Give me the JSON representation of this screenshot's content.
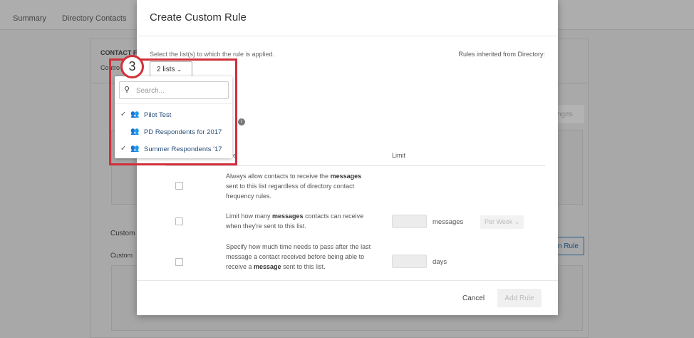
{
  "background": {
    "tabs": [
      "Summary",
      "Directory Contacts"
    ],
    "contact_heading": "CONTACT F",
    "contact_sub": "Contro",
    "custom_heading": "Custom",
    "custom_sub": "Custom",
    "save_changes_fragment": "nges",
    "add_rule_fragment": "n Rule"
  },
  "modal": {
    "title": "Create Custom Rule",
    "select_label": "Select the list(s) to which the rule is applied.",
    "inherited_label": "Rules inherited from Directory:",
    "lists_button": "2 lists",
    "column_rule_fragment": "e",
    "column_limit": "Limit",
    "rules": [
      {
        "html_parts": [
          "Always allow contacts to receive the ",
          "messages",
          " sent to this list regardless of directory contact frequency rules."
        ]
      },
      {
        "html_parts": [
          "Limit how many ",
          "messages",
          " contacts can receive when they're sent to this list."
        ],
        "unit": "messages",
        "period": "Per Week"
      },
      {
        "html_parts": [
          "Specify how much time needs to pass after the last message a contact received before being able to receive a ",
          "message",
          " sent to this list."
        ],
        "unit": "days"
      }
    ],
    "cancel": "Cancel",
    "add_rule": "Add Rule"
  },
  "dropdown": {
    "search_placeholder": "Search...",
    "items": [
      {
        "label": "Pilot Test",
        "checked": true
      },
      {
        "label": "PD Respondents for 2017",
        "checked": false
      },
      {
        "label": "Summer Respondents '17",
        "checked": true
      }
    ]
  },
  "annotation": {
    "step": "3",
    "color": "#d0303a"
  }
}
